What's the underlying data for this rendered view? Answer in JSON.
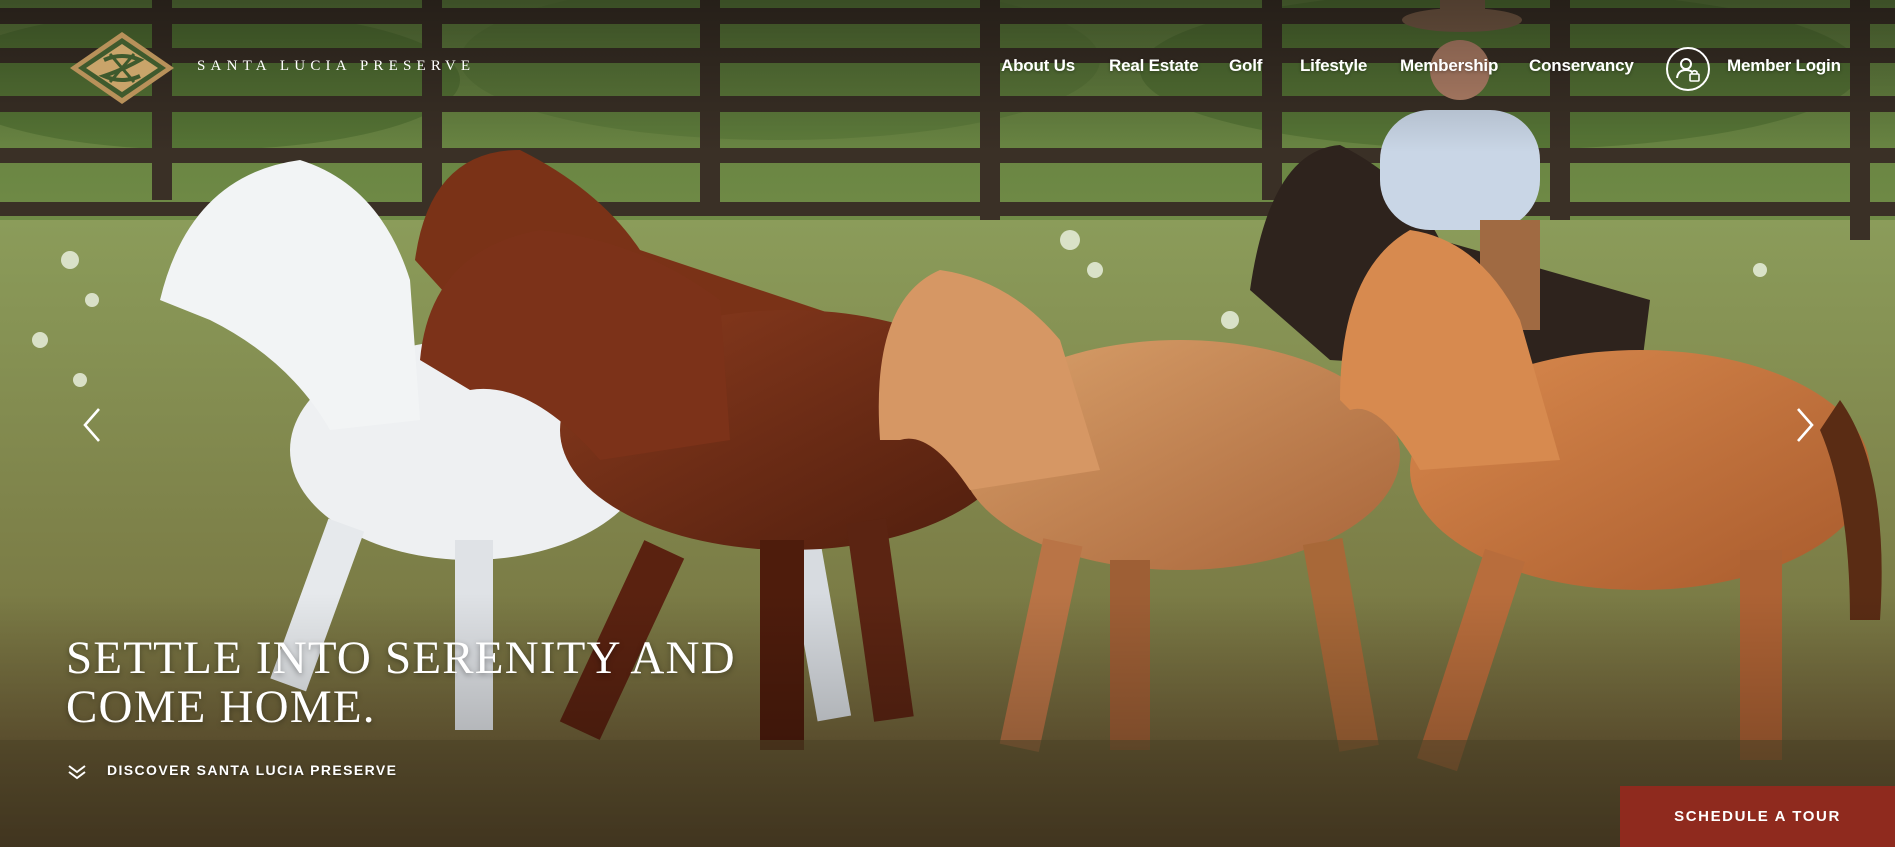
{
  "brand": {
    "name": "SANTA LUCIA PRESERVE",
    "logo_icon": "diamond-knot-emblem-icon",
    "colors": {
      "logo_gold": "#b8915a",
      "logo_green": "#3f5a2d",
      "cta_red": "#8f2a1e"
    }
  },
  "nav": {
    "items": [
      {
        "label": "About Us"
      },
      {
        "label": "Real Estate"
      },
      {
        "label": "Golf"
      },
      {
        "label": "Lifestyle"
      },
      {
        "label": "Membership"
      },
      {
        "label": "Conservancy"
      }
    ],
    "login": {
      "label": "Member Login",
      "icon": "user-lock-icon"
    }
  },
  "hero": {
    "headline_line1": "SETTLE INTO SERENITY AND",
    "headline_line2": "COME HOME.",
    "discover_label": "DISCOVER SANTA LUCIA PRESERVE",
    "discover_icon": "double-chevron-down-icon",
    "prev_icon": "chevron-left-icon",
    "next_icon": "chevron-right-icon"
  },
  "cta": {
    "label": "SCHEDULE A TOUR"
  }
}
